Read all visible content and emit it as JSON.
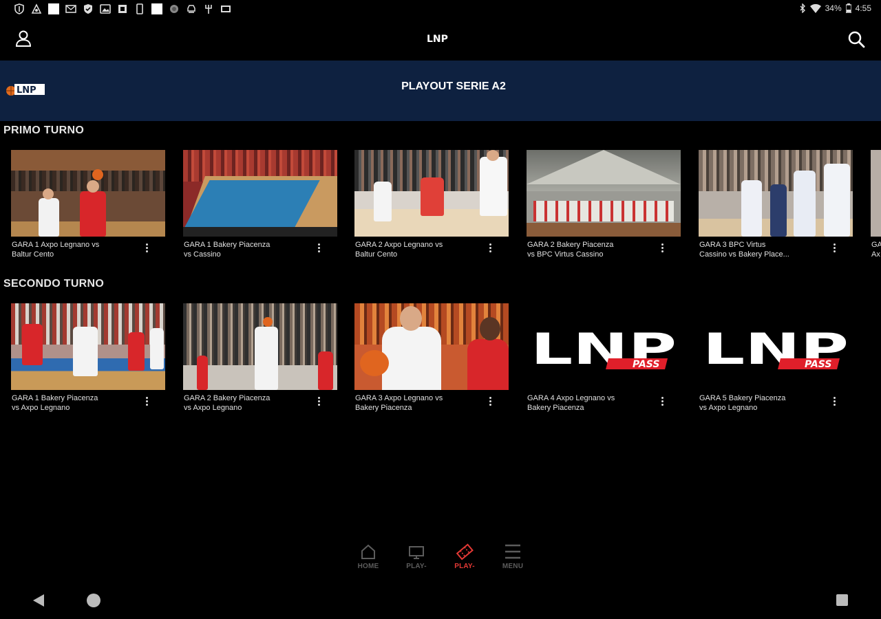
{
  "status_bar": {
    "left_icons": [
      "shield-icon",
      "android-auto-icon",
      "white-square-icon",
      "mail-icon",
      "security-icon",
      "photo-icon",
      "sim-icon",
      "white-square-icon",
      "vpn-icon",
      "car-icon",
      "pitchfork-icon",
      "gallery-icon"
    ],
    "battery": "34%",
    "time": "4:55"
  },
  "app_bar": {
    "brand": "LNP"
  },
  "banner": {
    "title": "PLAYOUT SERIE A2",
    "color": "#0e2140"
  },
  "sections": [
    {
      "title": "PRIMO TURNO",
      "cards": [
        {
          "line1": "GARA 1 Axpo Legnano vs",
          "line2": "Baltur Cento"
        },
        {
          "line1": "GARA 1 Bakery Piacenza",
          "line2": "vs Cassino"
        },
        {
          "line1": "GARA 2 Axpo Legnano vs",
          "line2": "Baltur Cento"
        },
        {
          "line1": "GARA 2 Bakery Piacenza",
          "line2": "vs BPC Virtus Cassino"
        },
        {
          "line1": "GARA 3 BPC Virtus",
          "line2": "Cassino vs Bakery Place..."
        },
        {
          "line1": "GA",
          "line2": "Ax"
        }
      ]
    },
    {
      "title": "SECONDO TURNO",
      "cards": [
        {
          "line1": "GARA 1 Bakery Piacenza",
          "line2": "vs Axpo Legnano"
        },
        {
          "line1": "GARA 2 Bakery Piacenza",
          "line2": "vs Axpo Legnano"
        },
        {
          "line1": "GARA 3 Axpo Legnano vs",
          "line2": "Bakery Piacenza"
        },
        {
          "line1": "GARA 4 Axpo Legnano vs",
          "line2": "Bakery Piacenza"
        },
        {
          "line1": "GARA 5 Bakery Piacenza",
          "line2": "vs Axpo Legnano"
        }
      ]
    }
  ],
  "placeholder_logo": {
    "main": "LNP",
    "sub": "PASS"
  },
  "bottom_nav": {
    "items": [
      {
        "label": "HOME",
        "icon": "home-icon",
        "active": false
      },
      {
        "label": "PLAY-",
        "icon": "tv-icon",
        "active": false
      },
      {
        "label": "PLAY-",
        "icon": "ticket-icon",
        "active": true
      },
      {
        "label": "MENU",
        "icon": "menu-icon",
        "active": false
      }
    ],
    "active_color": "#e53935",
    "inactive_color": "#5c5c5c"
  }
}
